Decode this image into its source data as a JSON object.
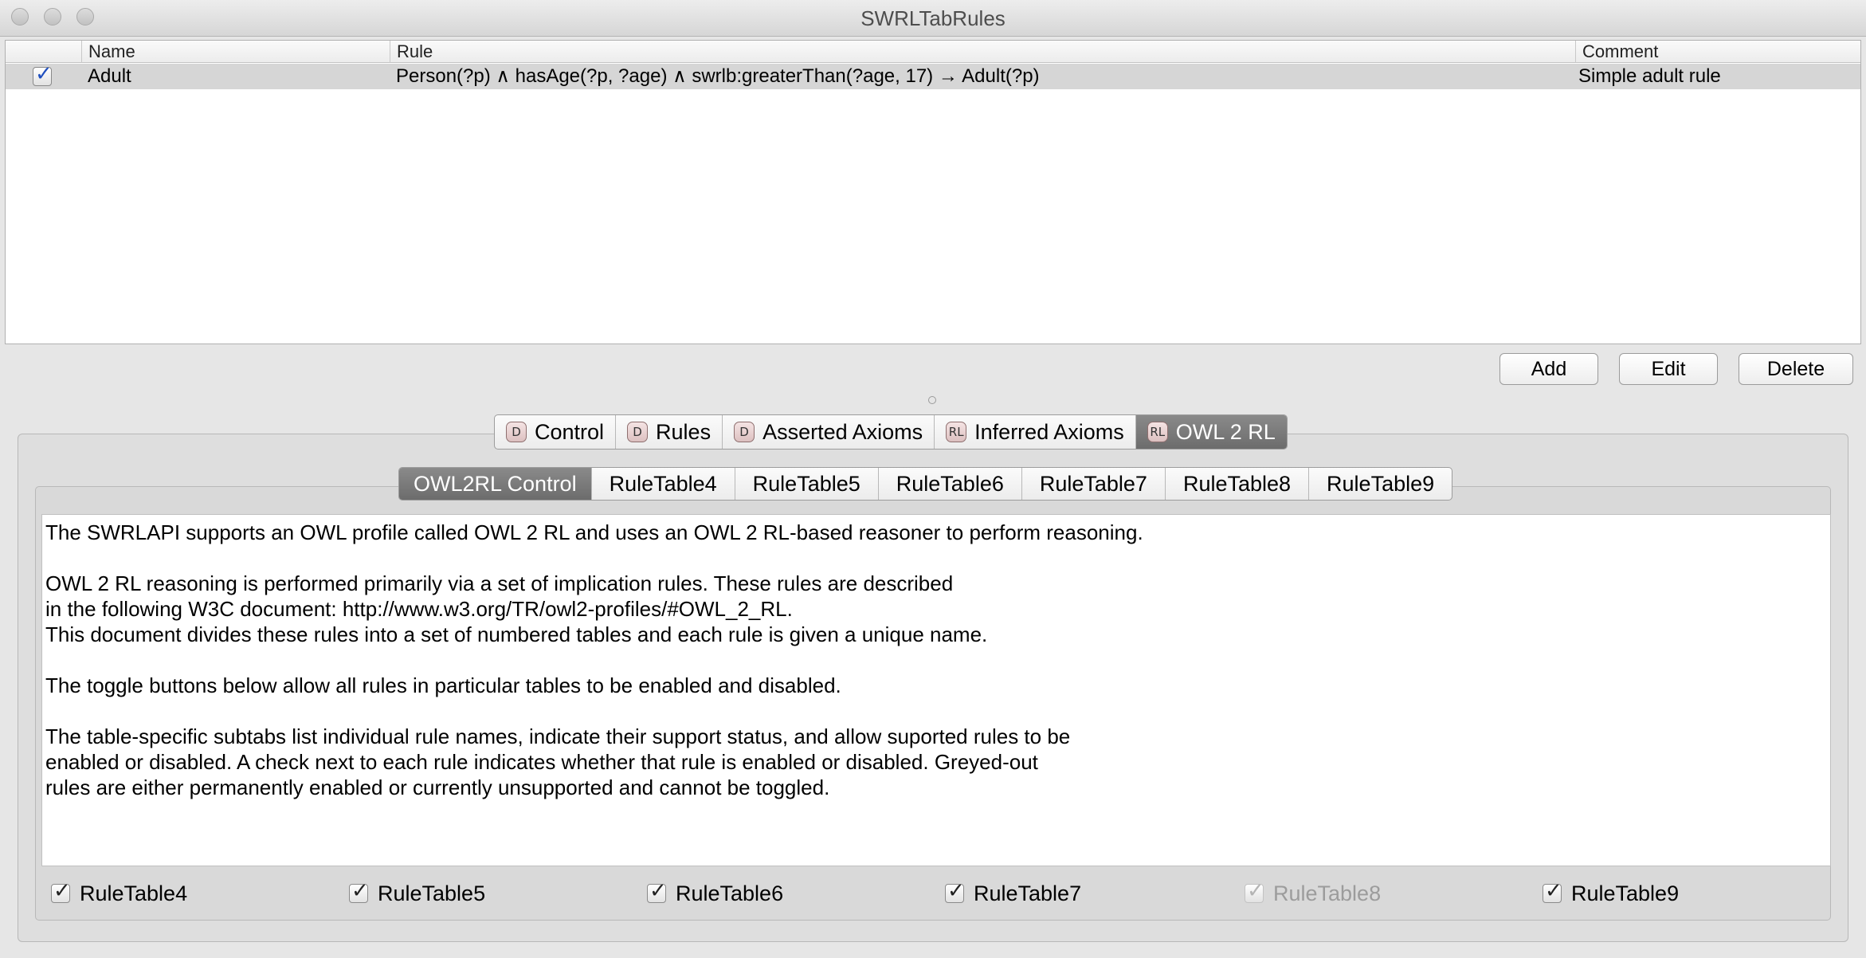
{
  "window": {
    "title": "SWRLTabRules"
  },
  "rules_table": {
    "columns": [
      "Name",
      "Rule",
      "Comment"
    ],
    "rows": [
      {
        "enabled": true,
        "name": "Adult",
        "rule": "Person(?p) ∧ hasAge(?p, ?age) ∧ swrlb:greaterThan(?age, 17) →  Adult(?p)",
        "comment": "Simple adult rule"
      }
    ]
  },
  "buttons": {
    "add": "Add",
    "edit": "Edit",
    "delete": "Delete"
  },
  "outer_tabs": [
    {
      "label": "Control",
      "icon": "D",
      "selected": false
    },
    {
      "label": "Rules",
      "icon": "D",
      "selected": false
    },
    {
      "label": "Asserted Axioms",
      "icon": "D",
      "selected": false
    },
    {
      "label": "Inferred Axioms",
      "icon": "RL",
      "selected": false
    },
    {
      "label": "OWL 2 RL",
      "icon": "RL",
      "selected": true
    }
  ],
  "inner_tabs": [
    {
      "label": "OWL2RL Control",
      "selected": true
    },
    {
      "label": "RuleTable4",
      "selected": false
    },
    {
      "label": "RuleTable5",
      "selected": false
    },
    {
      "label": "RuleTable6",
      "selected": false
    },
    {
      "label": "RuleTable7",
      "selected": false
    },
    {
      "label": "RuleTable8",
      "selected": false
    },
    {
      "label": "RuleTable9",
      "selected": false
    }
  ],
  "description": {
    "p1": "The SWRLAPI supports an OWL profile called OWL 2 RL and uses an OWL 2 RL-based reasoner to perform reasoning.",
    "p2": "OWL 2 RL reasoning is performed primarily via a set of implication rules. These rules are described\nin the following W3C document: http://www.w3.org/TR/owl2-profiles/#OWL_2_RL.\nThis document divides these rules into a set of numbered tables and each rule is given a unique name.",
    "p3": "The toggle buttons below allow all rules in particular tables to be enabled and disabled.",
    "p4": "The table-specific subtabs list individual rule names, indicate their support status, and allow suported rules to be\nenabled or disabled. A check next to each rule indicates whether that rule is enabled or disabled. Greyed-out\nrules are either permanently enabled or currently unsupported and cannot be toggled."
  },
  "toggles": [
    {
      "label": "RuleTable4",
      "checked": true,
      "enabled": true
    },
    {
      "label": "RuleTable5",
      "checked": true,
      "enabled": true
    },
    {
      "label": "RuleTable6",
      "checked": true,
      "enabled": true
    },
    {
      "label": "RuleTable7",
      "checked": true,
      "enabled": true
    },
    {
      "label": "RuleTable8",
      "checked": true,
      "enabled": false
    },
    {
      "label": "RuleTable9",
      "checked": true,
      "enabled": true
    }
  ]
}
